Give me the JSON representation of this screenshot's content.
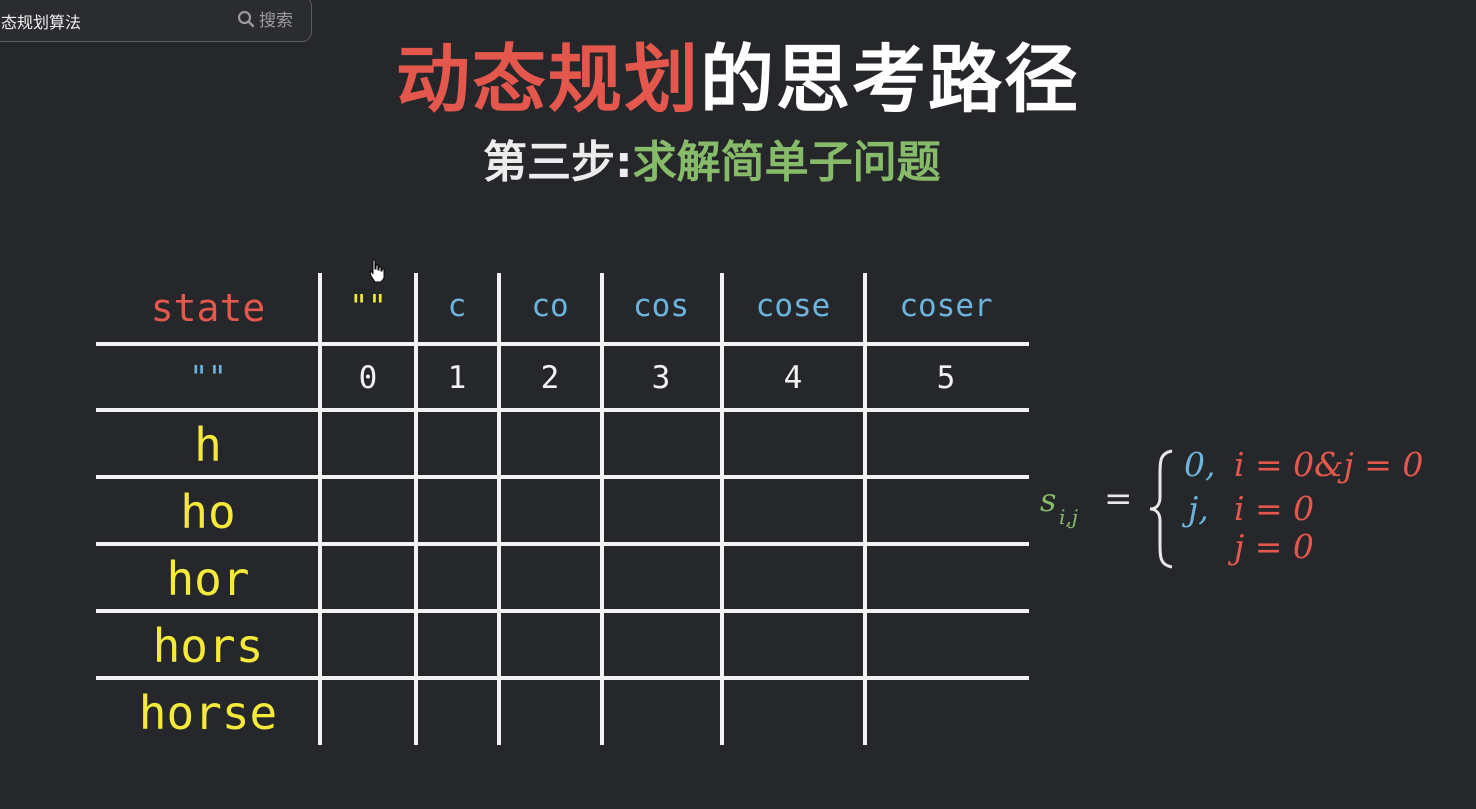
{
  "search": {
    "query": "态规划算法",
    "button_label": "搜索"
  },
  "title": {
    "accent": "动态规划",
    "rest": "的思考路径"
  },
  "subtitle": {
    "label": "第三步:",
    "accent": "求解简单子问题"
  },
  "table": {
    "corner": "state",
    "columns": [
      "\"\"",
      "c",
      "co",
      "cos",
      "cose",
      "coser"
    ],
    "first_row": {
      "label": "\"\"",
      "values": [
        "0",
        "1",
        "2",
        "3",
        "4",
        "5"
      ]
    },
    "row_labels": [
      "h",
      "ho",
      "hor",
      "hors",
      "horse"
    ]
  },
  "formula": {
    "symbol": "s",
    "subscript": "i,j",
    "equals": "=",
    "cases": [
      {
        "value": "0,",
        "condition": "i = 0&j = 0"
      },
      {
        "value": "j,",
        "condition": "i = 0"
      },
      {
        "value": "",
        "condition": "j = 0"
      }
    ]
  },
  "colors": {
    "background": "#26272b",
    "title_accent": "#e4574d",
    "subtitle_accent": "#86bb6a",
    "header_blue": "#6cb4dc",
    "row_yellow": "#f5ea3a"
  },
  "icons": {
    "search": "search-icon",
    "cursor": "hand-cursor-icon",
    "brace": "left-brace-icon"
  }
}
